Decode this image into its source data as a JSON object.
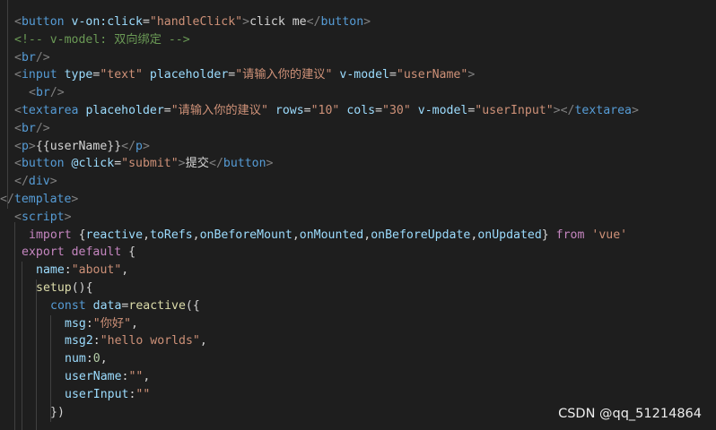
{
  "colors": {
    "background": "#1e1e1e",
    "punctuation": "#808080",
    "tag": "#569cd6",
    "attribute": "#9cdcfe",
    "string": "#ce9178",
    "text": "#d4d4d4",
    "comment": "#6a9955",
    "keyword": "#c586c0",
    "function": "#dcdcaa",
    "number": "#b5cea8"
  },
  "code": {
    "lines": [
      [
        [
          "punct",
          "<"
        ],
        [
          "tag",
          "button"
        ],
        [
          "text",
          " "
        ],
        [
          "attr",
          "v-on:click"
        ],
        [
          "text",
          "="
        ],
        [
          "str",
          "\"handleClick\""
        ],
        [
          "punct",
          ">"
        ],
        [
          "text",
          "click me"
        ],
        [
          "punct",
          "</"
        ],
        [
          "tag",
          "button"
        ],
        [
          "punct",
          ">"
        ]
      ],
      [
        [
          "comment",
          "<!-- v-model: 双向绑定 -->"
        ]
      ],
      [
        [
          "punct",
          "<"
        ],
        [
          "tag",
          "br"
        ],
        [
          "punct",
          "/>"
        ]
      ],
      [
        [
          "punct",
          "<"
        ],
        [
          "tag",
          "input"
        ],
        [
          "text",
          " "
        ],
        [
          "attr",
          "type"
        ],
        [
          "text",
          "="
        ],
        [
          "str",
          "\"text\""
        ],
        [
          "text",
          " "
        ],
        [
          "attr",
          "placeholder"
        ],
        [
          "text",
          "="
        ],
        [
          "str",
          "\"请输入你的建议\""
        ],
        [
          "text",
          " "
        ],
        [
          "attr",
          "v-model"
        ],
        [
          "text",
          "="
        ],
        [
          "str",
          "\"userName\""
        ],
        [
          "punct",
          ">"
        ]
      ],
      [
        [
          "punct",
          "<"
        ],
        [
          "tag",
          "br"
        ],
        [
          "punct",
          "/>"
        ]
      ],
      [
        [
          "punct",
          "<"
        ],
        [
          "tag",
          "textarea"
        ],
        [
          "text",
          " "
        ],
        [
          "attr",
          "placeholder"
        ],
        [
          "text",
          "="
        ],
        [
          "str",
          "\"请输入你的建议\""
        ],
        [
          "text",
          " "
        ],
        [
          "attr",
          "rows"
        ],
        [
          "text",
          "="
        ],
        [
          "str",
          "\"10\""
        ],
        [
          "text",
          " "
        ],
        [
          "attr",
          "cols"
        ],
        [
          "text",
          "="
        ],
        [
          "str",
          "\"30\""
        ],
        [
          "text",
          " "
        ],
        [
          "attr",
          "v-model"
        ],
        [
          "text",
          "="
        ],
        [
          "str",
          "\"userInput\""
        ],
        [
          "punct",
          "></"
        ],
        [
          "tag",
          "textarea"
        ],
        [
          "punct",
          ">"
        ]
      ],
      [
        [
          "punct",
          "<"
        ],
        [
          "tag",
          "br"
        ],
        [
          "punct",
          "/>"
        ]
      ],
      [
        [
          "punct",
          "<"
        ],
        [
          "tag",
          "p"
        ],
        [
          "punct",
          ">"
        ],
        [
          "text",
          "{{userName}}"
        ],
        [
          "punct",
          "</"
        ],
        [
          "tag",
          "p"
        ],
        [
          "punct",
          ">"
        ]
      ],
      [
        [
          "punct",
          "<"
        ],
        [
          "tag",
          "button"
        ],
        [
          "text",
          " "
        ],
        [
          "attr",
          "@click"
        ],
        [
          "text",
          "="
        ],
        [
          "str",
          "\"submit\""
        ],
        [
          "punct",
          ">"
        ],
        [
          "text",
          "提交"
        ],
        [
          "punct",
          "</"
        ],
        [
          "tag",
          "button"
        ],
        [
          "punct",
          ">"
        ]
      ],
      [
        [
          "punct",
          "</"
        ],
        [
          "tag",
          "div"
        ],
        [
          "punct",
          ">"
        ]
      ],
      [
        [
          "punct",
          "</"
        ],
        [
          "tag",
          "template"
        ],
        [
          "punct",
          ">"
        ]
      ],
      [
        [
          "punct",
          "<"
        ],
        [
          "tag",
          "script"
        ],
        [
          "punct",
          ">"
        ]
      ],
      [
        [
          "kw",
          "import"
        ],
        [
          "text",
          " {"
        ],
        [
          "var",
          "reactive"
        ],
        [
          "text",
          ","
        ],
        [
          "var",
          "toRefs"
        ],
        [
          "text",
          ","
        ],
        [
          "var",
          "onBeforeMount"
        ],
        [
          "text",
          ","
        ],
        [
          "var",
          "onMounted"
        ],
        [
          "text",
          ","
        ],
        [
          "var",
          "onBeforeUpdate"
        ],
        [
          "text",
          ","
        ],
        [
          "var",
          "onUpdated"
        ],
        [
          "text",
          "} "
        ],
        [
          "kw",
          "from"
        ],
        [
          "text",
          " "
        ],
        [
          "str",
          "'vue'"
        ]
      ],
      [
        [
          "kw",
          "export"
        ],
        [
          "text",
          " "
        ],
        [
          "kw",
          "default"
        ],
        [
          "text",
          " {"
        ]
      ],
      [
        [
          "var",
          "name"
        ],
        [
          "text",
          ":"
        ],
        [
          "str",
          "\"about\""
        ],
        [
          "text",
          ","
        ]
      ],
      [
        [
          "func",
          "setup"
        ],
        [
          "text",
          "(){"
        ]
      ],
      [
        [
          "kw2",
          "const"
        ],
        [
          "text",
          " "
        ],
        [
          "var",
          "data"
        ],
        [
          "text",
          "="
        ],
        [
          "func",
          "reactive"
        ],
        [
          "text",
          "({"
        ]
      ],
      [
        [
          "var",
          "msg"
        ],
        [
          "text",
          ":"
        ],
        [
          "str",
          "\"你好\""
        ],
        [
          "text",
          ","
        ]
      ],
      [
        [
          "var",
          "msg2"
        ],
        [
          "text",
          ":"
        ],
        [
          "str",
          "\"hello worlds\""
        ],
        [
          "text",
          ","
        ]
      ],
      [
        [
          "var",
          "num"
        ],
        [
          "text",
          ":"
        ],
        [
          "num",
          "0"
        ],
        [
          "text",
          ","
        ]
      ],
      [
        [
          "var",
          "userName"
        ],
        [
          "text",
          ":"
        ],
        [
          "str",
          "\"\""
        ],
        [
          "text",
          ","
        ]
      ],
      [
        [
          "var",
          "userInput"
        ],
        [
          "text",
          ":"
        ],
        [
          "str",
          "\"\""
        ]
      ],
      [
        [
          "text",
          "})"
        ]
      ]
    ]
  },
  "watermark": {
    "text": "CSDN @qq_51214864"
  }
}
